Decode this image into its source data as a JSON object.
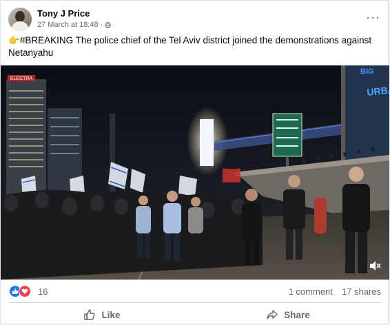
{
  "post": {
    "author": "Tony J Price",
    "timestamp": "27 March at 18:48",
    "separator": "·",
    "more_label": "···",
    "emoji": "👉",
    "text": "#BREAKING The police chief of the Tel Aviv district joined the demonstrations against Netanyahu"
  },
  "video": {
    "sign_left": "ELECTRA",
    "sign_right_top": "BIG",
    "sign_right": "URBAN"
  },
  "stats": {
    "reaction_count": "16",
    "comments": "1 comment",
    "shares": "17 shares"
  },
  "actions": {
    "like": "Like",
    "share": "Share"
  },
  "colors": {
    "facebook_blue": "#1877f2",
    "love_red": "#f33e58",
    "secondary_text": "#65676b"
  },
  "icons": [
    "globe-icon",
    "more-options-icon",
    "pointing-hand-icon",
    "like-reaction-icon",
    "love-reaction-icon",
    "thumbs-up-icon",
    "share-arrow-icon",
    "mute-icon"
  ]
}
